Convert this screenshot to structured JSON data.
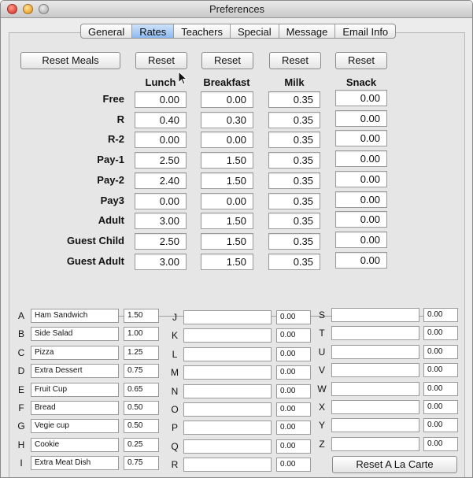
{
  "window": {
    "title": "Preferences"
  },
  "tabs": [
    "General",
    "Rates",
    "Teachers",
    "Special",
    "Message",
    "Email Info"
  ],
  "active_tab": "Rates",
  "buttons": {
    "reset_meals": "Reset Meals",
    "reset_lunch": "Reset",
    "reset_breakfast": "Reset",
    "reset_milk": "Reset",
    "reset_snack": "Reset",
    "reset_alacarte": "Reset A La Carte"
  },
  "columns": [
    "Lunch",
    "Breakfast",
    "Milk",
    "Snack"
  ],
  "rates": [
    {
      "label": "Free",
      "values": [
        "0.00",
        "0.00",
        "0.35",
        "0.00"
      ]
    },
    {
      "label": "R",
      "values": [
        "0.40",
        "0.30",
        "0.35",
        "0.00"
      ]
    },
    {
      "label": "R-2",
      "values": [
        "0.00",
        "0.00",
        "0.35",
        "0.00"
      ]
    },
    {
      "label": "Pay-1",
      "values": [
        "2.50",
        "1.50",
        "0.35",
        "0.00"
      ]
    },
    {
      "label": "Pay-2",
      "values": [
        "2.40",
        "1.50",
        "0.35",
        "0.00"
      ]
    },
    {
      "label": "Pay3",
      "values": [
        "0.00",
        "0.00",
        "0.35",
        "0.00"
      ]
    },
    {
      "label": "Adult",
      "values": [
        "3.00",
        "1.50",
        "0.35",
        "0.00"
      ]
    },
    {
      "label": "Guest Child",
      "values": [
        "2.50",
        "1.50",
        "0.35",
        "0.00"
      ]
    },
    {
      "label": "Guest Adult",
      "values": [
        "3.00",
        "1.50",
        "0.35",
        "0.00"
      ]
    }
  ],
  "alacarte": [
    {
      "letter": "A",
      "name": "Ham Sandwich",
      "price": "1.50"
    },
    {
      "letter": "B",
      "name": "Side Salad",
      "price": "1.00"
    },
    {
      "letter": "C",
      "name": "Pizza",
      "price": "1.25"
    },
    {
      "letter": "D",
      "name": "Extra Dessert",
      "price": "0.75"
    },
    {
      "letter": "E",
      "name": "Fruit Cup",
      "price": "0.65"
    },
    {
      "letter": "F",
      "name": "Bread",
      "price": "0.50"
    },
    {
      "letter": "G",
      "name": "Vegie cup",
      "price": "0.50"
    },
    {
      "letter": "H",
      "name": "Cookie",
      "price": "0.25"
    },
    {
      "letter": "I",
      "name": "Extra Meat Dish",
      "price": "0.75"
    },
    {
      "letter": "J",
      "name": "",
      "price": "0.00"
    },
    {
      "letter": "K",
      "name": "",
      "price": "0.00"
    },
    {
      "letter": "L",
      "name": "",
      "price": "0.00"
    },
    {
      "letter": "M",
      "name": "",
      "price": "0.00"
    },
    {
      "letter": "N",
      "name": "",
      "price": "0.00"
    },
    {
      "letter": "O",
      "name": "",
      "price": "0.00"
    },
    {
      "letter": "P",
      "name": "",
      "price": "0.00"
    },
    {
      "letter": "Q",
      "name": "",
      "price": "0.00"
    },
    {
      "letter": "R",
      "name": "",
      "price": "0.00"
    },
    {
      "letter": "S",
      "name": "",
      "price": "0.00"
    },
    {
      "letter": "T",
      "name": "",
      "price": "0.00"
    },
    {
      "letter": "U",
      "name": "",
      "price": "0.00"
    },
    {
      "letter": "V",
      "name": "",
      "price": "0.00"
    },
    {
      "letter": "W",
      "name": "",
      "price": "0.00"
    },
    {
      "letter": "X",
      "name": "",
      "price": "0.00"
    },
    {
      "letter": "Y",
      "name": "",
      "price": "0.00"
    },
    {
      "letter": "Z",
      "name": "",
      "price": "0.00"
    }
  ],
  "colors": {
    "active_tab": "#8cbaf0",
    "close": "#e2463a",
    "minimize": "#f0a531",
    "zoom": "#b8b8b8"
  },
  "icons": [
    "close-icon",
    "minimize-icon",
    "zoom-icon",
    "pointer-cursor-icon"
  ]
}
